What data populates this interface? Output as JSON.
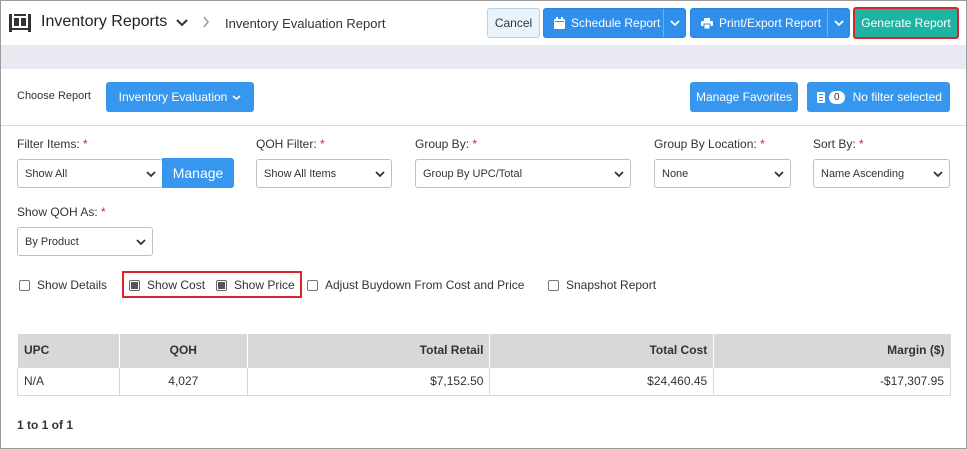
{
  "header": {
    "app_title": "Inventory Reports",
    "breadcrumb": "Inventory Evaluation Report",
    "cancel_label": "Cancel",
    "schedule_label": "Schedule Report",
    "print_label": "Print/Export Report",
    "generate_label": "Generate Report"
  },
  "report": {
    "choose_label": "Choose Report",
    "selected_report": "Inventory Evaluation",
    "favorites_label": "Manage Favorites",
    "filter_count": "0",
    "filter_label": "No filter selected"
  },
  "filters": {
    "filter_items": {
      "label": "Filter Items:",
      "value": "Show All",
      "manage_label": "Manage"
    },
    "qoh_filter": {
      "label": "QOH Filter:",
      "value": "Show All Items"
    },
    "group_by": {
      "label": "Group By:",
      "value": "Group By UPC/Total"
    },
    "group_by_location": {
      "label": "Group By Location:",
      "value": "None"
    },
    "sort_by": {
      "label": "Sort By:",
      "value": "Name Ascending"
    },
    "show_qoh_as": {
      "label": "Show QOH As:",
      "value": "By Product"
    },
    "required_mark": "*"
  },
  "options": [
    {
      "label": "Show Details",
      "checked": false
    },
    {
      "label": "Show Cost",
      "checked": true
    },
    {
      "label": "Show Price",
      "checked": true
    },
    {
      "label": "Adjust Buydown From Cost and Price",
      "checked": false
    },
    {
      "label": "Snapshot Report",
      "checked": false
    }
  ],
  "table": {
    "columns": [
      "UPC",
      "QOH",
      "Total Retail",
      "Total Cost",
      "Margin ($)"
    ],
    "rows": [
      [
        "N/A",
        "4,027",
        "$7,152.50",
        "$24,460.45",
        "-$17,307.95"
      ]
    ]
  },
  "pager": "1 to 1 of 1",
  "colors": {
    "primary": "#3796ee",
    "generate": "#1fb3a4",
    "highlight": "#d9242a"
  }
}
